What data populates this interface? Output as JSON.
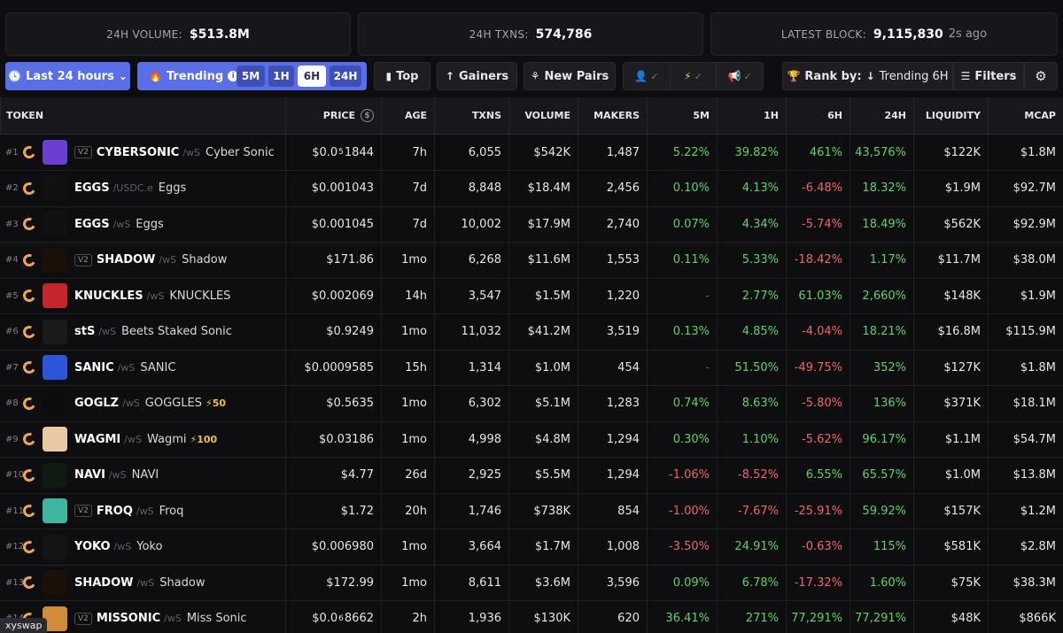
{
  "stats": {
    "volume_label": "24H VOLUME:",
    "volume_value": "$513.8M",
    "txns_label": "24H TXNS:",
    "txns_value": "574,786",
    "block_label": "LATEST BLOCK:",
    "block_value": "9,115,830",
    "block_ago": "2s ago"
  },
  "toolbar": {
    "time_filter": "Last 24 hours",
    "trending_label": "Trending",
    "trending_periods": [
      "5M",
      "1H",
      "6H",
      "24H"
    ],
    "trending_active": "6H",
    "top_label": "Top",
    "gainers_label": "Gainers",
    "new_pairs_label": "New Pairs",
    "rank_label": "Rank by:",
    "rank_value": "Trending 6H",
    "filters_label": "Filters"
  },
  "table": {
    "headers": {
      "token": "TOKEN",
      "price": "PRICE",
      "age": "AGE",
      "txns": "TXNS",
      "volume": "VOLUME",
      "makers": "MAKERS",
      "m5": "5M",
      "h1": "1H",
      "h6": "6H",
      "h24": "24H",
      "liquidity": "LIQUIDITY",
      "mcap": "MCAP"
    },
    "rows": [
      {
        "rank": "#1",
        "version": "V2",
        "symbol": "CYBERSONIC",
        "quote": "/wS",
        "name": "Cyber Sonic",
        "boost": "",
        "price_pre": "$0.0",
        "price_sub": "5",
        "price_post": "1844",
        "age": "7h",
        "txns": "6,055",
        "volume": "$542K",
        "makers": "1,487",
        "m5": "5.22%",
        "h1": "39.82%",
        "h6": "461%",
        "h24": "43,576%",
        "liquidity": "$122K",
        "mcap": "$1.8M",
        "logo_color": "#6b3fd0"
      },
      {
        "rank": "#2",
        "version": "",
        "symbol": "EGGS",
        "quote": "/USDC.e",
        "name": "Eggs",
        "boost": "",
        "price_pre": "$0.001043",
        "price_sub": "",
        "price_post": "",
        "age": "7d",
        "txns": "8,848",
        "volume": "$18.4M",
        "makers": "2,456",
        "m5": "0.10%",
        "h1": "4.13%",
        "h6": "-6.48%",
        "h24": "18.32%",
        "liquidity": "$1.9M",
        "mcap": "$92.7M",
        "logo_color": "#111111"
      },
      {
        "rank": "#3",
        "version": "",
        "symbol": "EGGS",
        "quote": "/wS",
        "name": "Eggs",
        "boost": "",
        "price_pre": "$0.001045",
        "price_sub": "",
        "price_post": "",
        "age": "7d",
        "txns": "10,002",
        "volume": "$17.9M",
        "makers": "2,740",
        "m5": "0.07%",
        "h1": "4.34%",
        "h6": "-5.74%",
        "h24": "18.49%",
        "liquidity": "$562K",
        "mcap": "$92.9M",
        "logo_color": "#111111"
      },
      {
        "rank": "#4",
        "version": "V2",
        "symbol": "SHADOW",
        "quote": "/wS",
        "name": "Shadow",
        "boost": "",
        "price_pre": "$171.86",
        "price_sub": "",
        "price_post": "",
        "age": "1mo",
        "txns": "6,268",
        "volume": "$11.6M",
        "makers": "1,553",
        "m5": "0.11%",
        "h1": "5.33%",
        "h6": "-18.42%",
        "h24": "1.17%",
        "liquidity": "$11.7M",
        "mcap": "$38.0M",
        "logo_color": "#1a1209"
      },
      {
        "rank": "#5",
        "version": "",
        "symbol": "KNUCKLES",
        "quote": "/wS",
        "name": "KNUCKLES",
        "boost": "",
        "price_pre": "$0.002069",
        "price_sub": "",
        "price_post": "",
        "age": "14h",
        "txns": "3,547",
        "volume": "$1.5M",
        "makers": "1,220",
        "m5": "-",
        "h1": "2.77%",
        "h6": "61.03%",
        "h24": "2,660%",
        "liquidity": "$148K",
        "mcap": "$1.9M",
        "logo_color": "#c3272c"
      },
      {
        "rank": "#6",
        "version": "",
        "symbol": "stS",
        "quote": "/wS",
        "name": "Beets Staked Sonic",
        "boost": "",
        "price_pre": "$0.9249",
        "price_sub": "",
        "price_post": "",
        "age": "1mo",
        "txns": "11,032",
        "volume": "$41.2M",
        "makers": "3,519",
        "m5": "0.13%",
        "h1": "4.85%",
        "h6": "-4.04%",
        "h24": "18.21%",
        "liquidity": "$16.8M",
        "mcap": "$115.9M",
        "logo_color": "#1b1b1b"
      },
      {
        "rank": "#7",
        "version": "",
        "symbol": "SANIC",
        "quote": "/wS",
        "name": "SANIC",
        "boost": "",
        "price_pre": "$0.0009585",
        "price_sub": "",
        "price_post": "",
        "age": "15h",
        "txns": "1,314",
        "volume": "$1.0M",
        "makers": "454",
        "m5": "-",
        "h1": "51.50%",
        "h6": "-49.75%",
        "h24": "352%",
        "liquidity": "$127K",
        "mcap": "$1.8M",
        "logo_color": "#2c55d8"
      },
      {
        "rank": "#8",
        "version": "",
        "symbol": "GOGLZ",
        "quote": "/wS",
        "name": "GOGGLES",
        "boost": "⚡50",
        "price_pre": "$0.5635",
        "price_sub": "",
        "price_post": "",
        "age": "1mo",
        "txns": "6,302",
        "volume": "$5.1M",
        "makers": "1,283",
        "m5": "0.74%",
        "h1": "8.63%",
        "h6": "-5.80%",
        "h24": "136%",
        "liquidity": "$371K",
        "mcap": "$18.1M",
        "logo_color": "#0c0c0c"
      },
      {
        "rank": "#9",
        "version": "",
        "symbol": "WAGMI",
        "quote": "/wS",
        "name": "Wagmi",
        "boost": "⚡100",
        "price_pre": "$0.03186",
        "price_sub": "",
        "price_post": "",
        "age": "1mo",
        "txns": "4,998",
        "volume": "$4.8M",
        "makers": "1,294",
        "m5": "0.30%",
        "h1": "1.10%",
        "h6": "-5.62%",
        "h24": "96.17%",
        "liquidity": "$1.1M",
        "mcap": "$54.7M",
        "logo_color": "#e8c9a4"
      },
      {
        "rank": "#10",
        "version": "",
        "symbol": "NAVI",
        "quote": "/wS",
        "name": "NAVI",
        "boost": "",
        "price_pre": "$4.77",
        "price_sub": "",
        "price_post": "",
        "age": "26d",
        "txns": "2,925",
        "volume": "$5.5M",
        "makers": "1,294",
        "m5": "-1.06%",
        "h1": "-8.52%",
        "h6": "6.55%",
        "h24": "65.57%",
        "liquidity": "$1.0M",
        "mcap": "$13.8M",
        "logo_color": "#0f1a12"
      },
      {
        "rank": "#11",
        "version": "V2",
        "symbol": "FROQ",
        "quote": "/wS",
        "name": "Froq",
        "boost": "",
        "price_pre": "$1.72",
        "price_sub": "",
        "price_post": "",
        "age": "20h",
        "txns": "1,746",
        "volume": "$738K",
        "makers": "854",
        "m5": "-1.00%",
        "h1": "-7.67%",
        "h6": "-25.91%",
        "h24": "59.92%",
        "liquidity": "$157K",
        "mcap": "$1.2M",
        "logo_color": "#3fb5a2"
      },
      {
        "rank": "#12",
        "version": "",
        "symbol": "YOKO",
        "quote": "/wS",
        "name": "Yoko",
        "boost": "",
        "price_pre": "$0.006980",
        "price_sub": "",
        "price_post": "",
        "age": "1mo",
        "txns": "3,664",
        "volume": "$1.7M",
        "makers": "1,008",
        "m5": "-3.50%",
        "h1": "24.91%",
        "h6": "-0.63%",
        "h24": "115%",
        "liquidity": "$581K",
        "mcap": "$2.8M",
        "logo_color": "#141414"
      },
      {
        "rank": "#13",
        "version": "",
        "symbol": "SHADOW",
        "quote": "/wS",
        "name": "Shadow",
        "boost": "",
        "price_pre": "$172.99",
        "price_sub": "",
        "price_post": "",
        "age": "1mo",
        "txns": "8,611",
        "volume": "$3.6M",
        "makers": "3,596",
        "m5": "0.09%",
        "h1": "6.78%",
        "h6": "-17.32%",
        "h24": "1.60%",
        "liquidity": "$75K",
        "mcap": "$38.3M",
        "logo_color": "#1a1209"
      },
      {
        "rank": "#14",
        "version": "V2",
        "symbol": "MISSONIC",
        "quote": "/wS",
        "name": "Miss Sonic",
        "boost": "",
        "price_pre": "$0.0",
        "price_sub": "6",
        "price_post": "8662",
        "age": "2h",
        "txns": "1,936",
        "volume": "$130K",
        "makers": "620",
        "m5": "36.41%",
        "h1": "271%",
        "h6": "77,291%",
        "h24": "77,291%",
        "liquidity": "$48K",
        "mcap": "$866K",
        "logo_color": "#d08a3a"
      }
    ]
  },
  "watermark": "xyswap",
  "colors": {
    "accent": "#5a6ee8",
    "positive": "#5dd16a",
    "negative": "#f0636a",
    "chain": "#f0a64b"
  }
}
